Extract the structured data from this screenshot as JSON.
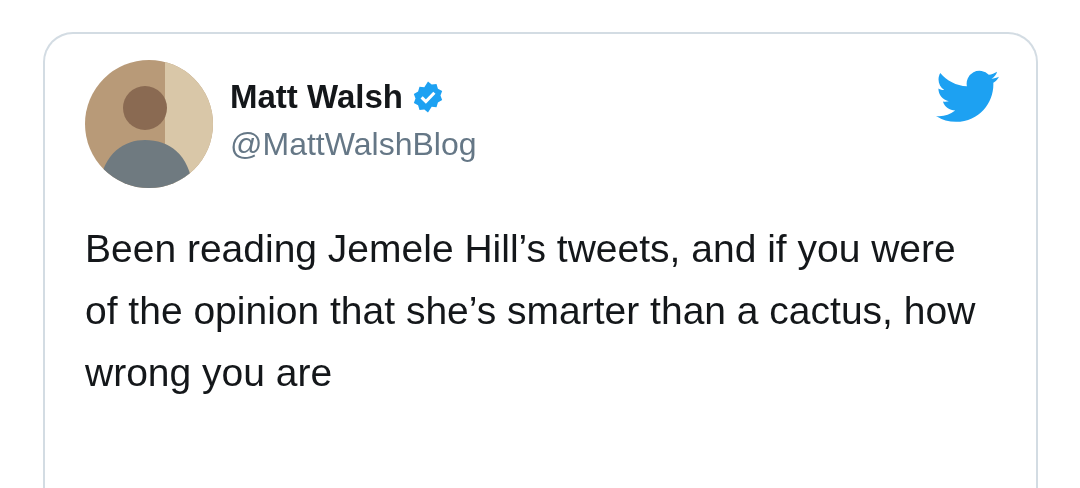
{
  "tweet": {
    "author": {
      "name": "Matt Walsh",
      "verified": true,
      "handle": "@MattWalshBlog"
    },
    "text": "Been reading Jemele Hill’s tweets, and if you were of the opinion that she’s smarter than a cactus, how wrong you are"
  }
}
